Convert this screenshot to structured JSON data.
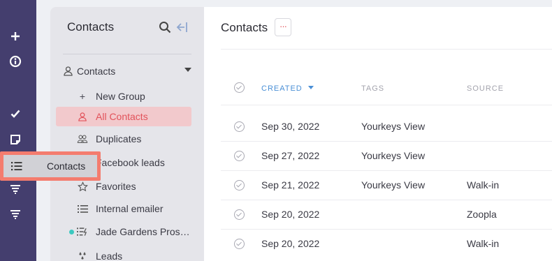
{
  "rail": {
    "icons": [
      "plus-icon",
      "info-icon",
      "check-icon",
      "note-icon",
      "list-icon",
      "funnel-icon",
      "funnel-icon"
    ]
  },
  "sidebar": {
    "title": "Contacts",
    "group": {
      "label": "Contacts"
    },
    "items": [
      {
        "label": "New Group",
        "icon": "plus-icon"
      },
      {
        "label": "All Contacts",
        "icon": "person-icon",
        "active": true
      },
      {
        "label": "Duplicates",
        "icon": "people-icon"
      },
      {
        "label": "Facebook leads",
        "icon": "list-icon"
      },
      {
        "label": "Favorites",
        "icon": "star-icon"
      },
      {
        "label": "Internal emailer",
        "icon": "list-icon"
      },
      {
        "label": "Jade Gardens Pros…",
        "icon": "list-lightning-icon"
      },
      {
        "label": "Leads",
        "icon": "drops-icon"
      }
    ]
  },
  "main": {
    "title": "Contacts",
    "more_label": "···",
    "columns": [
      "CREATED",
      "TAGS",
      "SOURCE"
    ],
    "rows": [
      {
        "created": "Sep 30, 2022",
        "tags": "Yourkeys View",
        "source": ""
      },
      {
        "created": "Sep 27, 2022",
        "tags": "Yourkeys View",
        "source": ""
      },
      {
        "created": "Sep 21, 2022",
        "tags": "Yourkeys View",
        "source": "Walk-in"
      },
      {
        "created": "Sep 20, 2022",
        "tags": "",
        "source": "Zoopla"
      },
      {
        "created": "Sep 20, 2022",
        "tags": "",
        "source": "Walk-in"
      }
    ]
  },
  "highlight": {
    "label": "Contacts"
  },
  "colors": {
    "rail": "#443e6e",
    "accent": "#e2525a",
    "sort": "#4a8fd6",
    "highlight": "#f47c6e",
    "status_dot": "#3cc9c0"
  }
}
